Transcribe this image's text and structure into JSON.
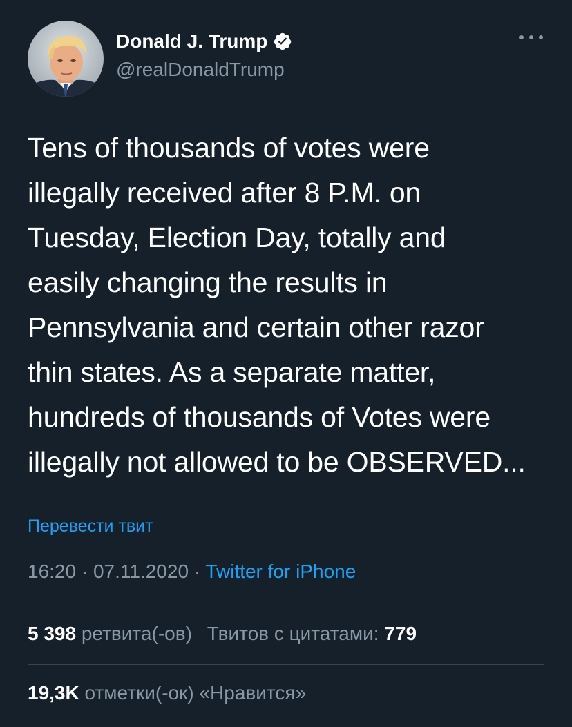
{
  "author": {
    "name": "Donald J. Trump",
    "handle": "@realDonaldTrump",
    "verified": true
  },
  "tweet": {
    "lines": [
      "Tens of thousands of votes were",
      "illegally received after 8 P.M. on",
      "Tuesday, Election Day, totally and",
      "easily changing the results in",
      "Pennsylvania and certain other razor",
      "thin states. As a separate matter,",
      "hundreds of thousands of Votes were",
      "illegally not allowed to be OBSERVED..."
    ]
  },
  "translate_label": "Перевести твит",
  "meta": {
    "time": "16:20",
    "separator": "·",
    "date": "07.11.2020",
    "source": "Twitter for iPhone"
  },
  "stats": {
    "retweets_count": "5 398",
    "retweets_label": "ретвита(-ов)",
    "quotes_label": "Твитов с цитатами:",
    "quotes_count": "779",
    "likes_count": "19,3K",
    "likes_label": "отметки(-ок) «Нравится»"
  },
  "colors": {
    "background": "#15202b",
    "text": "#ffffff",
    "secondary": "#8899a6",
    "accent": "#1da1f2",
    "divider": "#38444d"
  },
  "icons": {
    "verified": "verified-badge-icon",
    "more": "more-options-icon"
  }
}
